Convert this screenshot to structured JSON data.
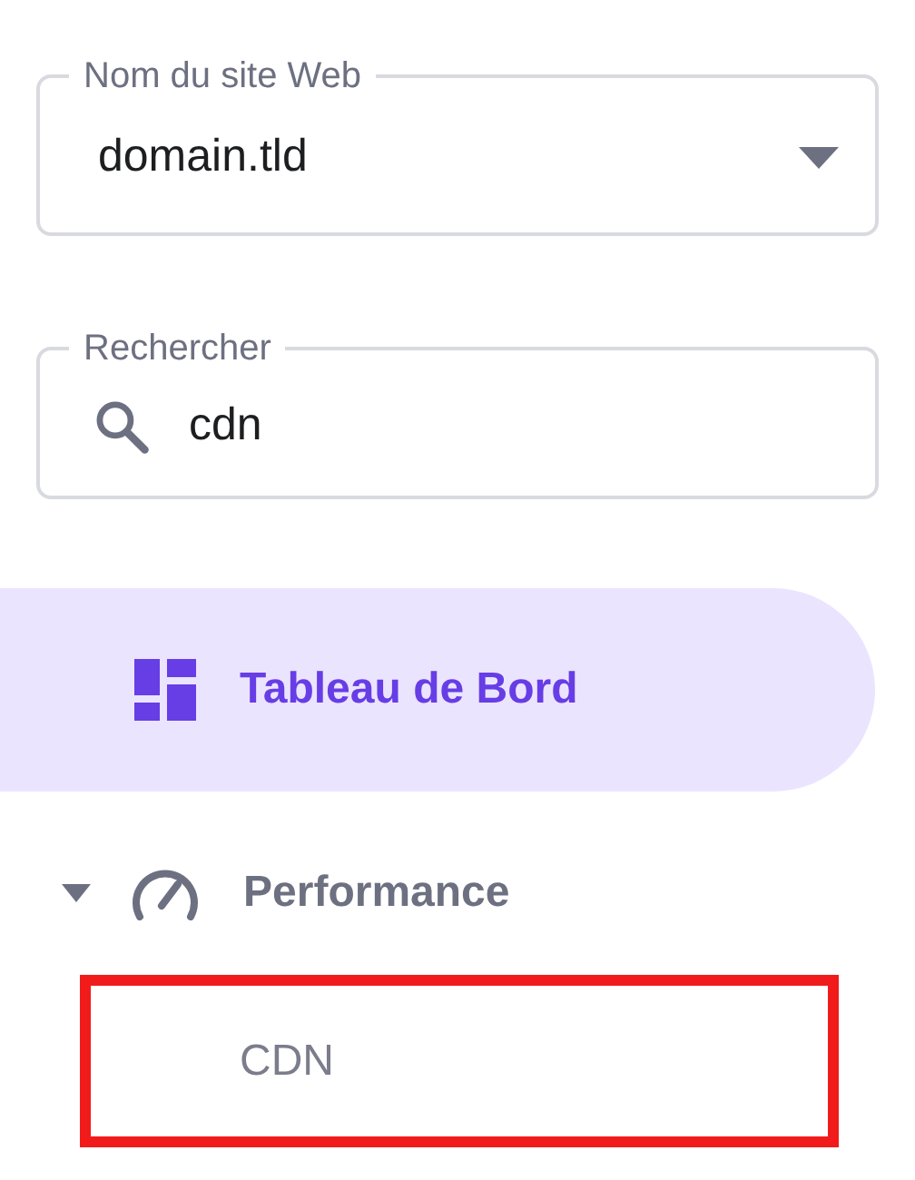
{
  "fields": [
    {
      "kind": "select",
      "label": "Nom du site Web",
      "value": "domain.tld"
    },
    {
      "kind": "search",
      "label": "Rechercher",
      "value": "cdn"
    }
  ],
  "menu": [
    {
      "label": "Tableau de Bord",
      "kind": "dashboard",
      "selected": true
    },
    {
      "label": "Performance",
      "kind": "gauge",
      "selected": false,
      "expanded": true,
      "children": [
        {
          "label": "CDN",
          "selected": false,
          "highlighted": true
        }
      ]
    }
  ]
}
